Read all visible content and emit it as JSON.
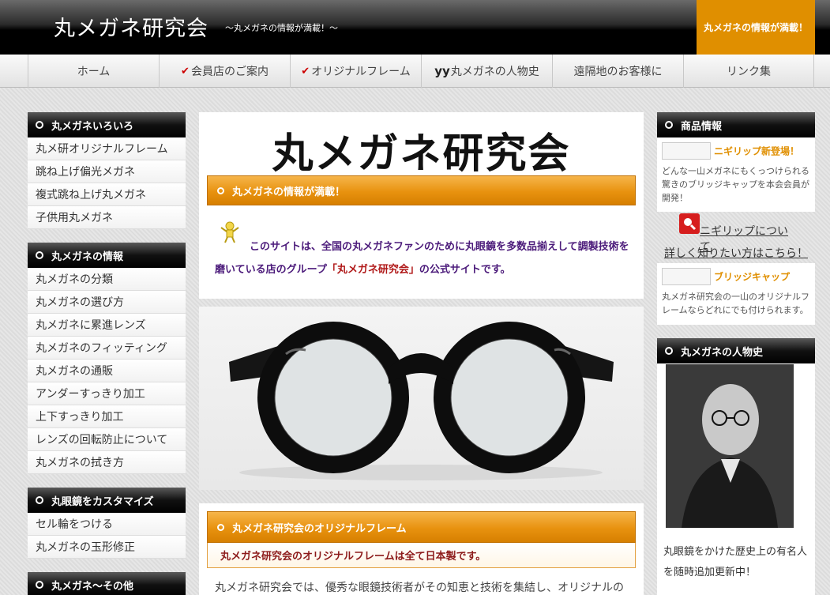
{
  "header": {
    "title": "丸メガネ研究会",
    "tagline": "～丸メガネの情報が満載！～",
    "banner": "丸メガネの情報が満載！"
  },
  "nav": {
    "items": [
      {
        "label": "ホーム",
        "icon": ""
      },
      {
        "label": "会員店のご案内",
        "icon": "check-icon"
      },
      {
        "label": "オリジナルフレーム",
        "icon": "check-icon"
      },
      {
        "label": "丸メガネの人物史",
        "icon": "glasses-icon"
      },
      {
        "label": "遠隔地のお客様に",
        "icon": ""
      },
      {
        "label": "リンク集",
        "icon": ""
      }
    ]
  },
  "left": {
    "box1": {
      "title": "丸メガネいろいろ",
      "links": [
        "丸メ研オリジナルフレーム",
        "跳ね上げ偏光メガネ",
        "複式跳ね上げ丸メガネ",
        "子供用丸メガネ"
      ]
    },
    "box2": {
      "title": "丸メガネの情報",
      "links": [
        "丸メガネの分類",
        "丸メガネの選び方",
        "丸メガネに累進レンズ",
        "丸メガネのフィッティング",
        "丸メガネの通販",
        "アンダーすっきり加工",
        "上下すっきり加工",
        "レンズの回転防止について",
        "丸メガネの拭き方"
      ]
    },
    "box3": {
      "title": "丸眼鏡をカスタマイズ",
      "links": [
        "セル輪をつける",
        "丸メガネの玉形修正"
      ]
    },
    "box4": {
      "title": "丸メガネ～その他"
    }
  },
  "main": {
    "logo": "丸メガネ研究会",
    "bar1": "丸メガネの情報が満載！",
    "intro_part1": "このサイトは、全国の丸メガネファンのために丸眼鏡を多数品揃えして調製技術を磨いている店のグループ",
    "intro_highlight": "「丸メガネ研究会」",
    "intro_part2": "の公式サイトです。",
    "bar2": "丸メガネ研究会のオリジナルフレーム",
    "strip": "丸メガネ研究会のオリジナルフレームは全て日本製です。",
    "body_text": "丸メガネ研究会では、優秀な眼鏡技術者がその知恵と技術を集結し、オリジナルの"
  },
  "right": {
    "box1": {
      "title": "商品情報"
    },
    "product1": {
      "title": "ニギリップ新登場！",
      "desc": "どんな一山メガネにもくっつけられる驚きのブリッジキャップを本会会員が開発！"
    },
    "link1": "ニギリップについて",
    "link2": "詳しく知りたい方はこちら！",
    "product2": {
      "title": "ブリッジキャップ",
      "desc": "丸メガネ研究会の一山のオリジナルフレームならどれにでも付けられます。"
    },
    "box2": {
      "title": "丸メガネの人物史"
    },
    "caption": "丸眼鏡をかけた歴史上の有名人を随時追加更新中！"
  },
  "colors": {
    "accent": "#e08f00",
    "intro_text": "#4b1a7a",
    "highlight": "#b01818"
  }
}
